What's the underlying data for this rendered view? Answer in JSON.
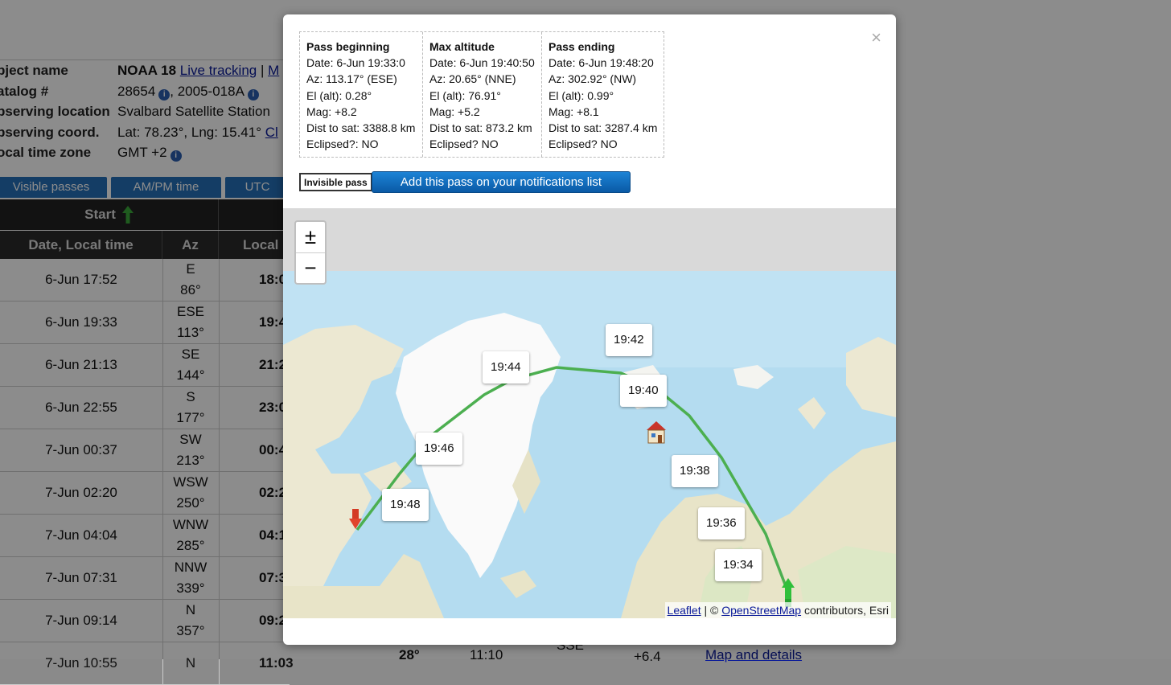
{
  "background": {
    "info": {
      "object_name_label": "bject name",
      "object_name": "NOAA 18",
      "live_tracking": "Live tracking",
      "sep": " | ",
      "more": "M",
      "catalog_label": "atalog #",
      "catalog": "28654",
      "intl": ", 2005-018A",
      "location_label": "bserving location",
      "location": "Svalbard Satellite Station",
      "coord_label": "bserving coord.",
      "coord": "Lat: 78.23°, Lng: 15.41°",
      "coord_link": "Cl",
      "tz_label": "ocal time zone",
      "tz": "GMT +2"
    },
    "tabs": [
      "Visible passes",
      "AM/PM time",
      "UTC"
    ],
    "table_head": {
      "start": "Start",
      "date_col": "Date, Local time",
      "az_col": "Az",
      "local_col": "Local"
    },
    "rows": [
      {
        "date": "6-Jun 17:52",
        "dir": "E",
        "deg": "86°",
        "t": "18:0"
      },
      {
        "date": "6-Jun 19:33",
        "dir": "ESE",
        "deg": "113°",
        "t": "19:4"
      },
      {
        "date": "6-Jun 21:13",
        "dir": "SE",
        "deg": "144°",
        "t": "21:2"
      },
      {
        "date": "6-Jun 22:55",
        "dir": "S",
        "deg": "177°",
        "t": "23:0"
      },
      {
        "date": "7-Jun 00:37",
        "dir": "SW",
        "deg": "213°",
        "t": "00:4"
      },
      {
        "date": "7-Jun 02:20",
        "dir": "WSW",
        "deg": "250°",
        "t": "02:2"
      },
      {
        "date": "7-Jun 04:04",
        "dir": "WNW",
        "deg": "285°",
        "t": "04:1"
      },
      {
        "date": "7-Jun 07:31",
        "dir": "NNW",
        "deg": "339°",
        "t": "07:3"
      },
      {
        "date": "7-Jun 09:14",
        "dir": "N",
        "deg": "357°",
        "t": "09:2"
      },
      {
        "date": "7-Jun 10:55",
        "dir": "N",
        "deg": "",
        "t": "11:03"
      }
    ],
    "last_row_extra": {
      "e": "E",
      "alt": "28°",
      "time": "11:10",
      "dir": "SSE",
      "mag": "+6.4",
      "link": "Map and details"
    }
  },
  "modal": {
    "close": "×",
    "beginning": {
      "title": "Pass beginning",
      "date": "Date: 6-Jun 19:33:0",
      "az": "Az: 113.17° (ESE)",
      "el": "El (alt): 0.28°",
      "mag": "Mag: +8.2",
      "dist": "Dist to sat: 3388.8 km",
      "eclipsed": "Eclipsed?: NO"
    },
    "max": {
      "title": "Max altitude",
      "date": "Date: 6-Jun 19:40:50",
      "az": "Az: 20.65° (NNE)",
      "el": "El (alt): 76.91°",
      "mag": "Mag: +5.2",
      "dist": "Dist to sat: 873.2 km",
      "eclipsed": "Eclipsed? NO"
    },
    "ending": {
      "title": "Pass ending",
      "date": "Date: 6-Jun 19:48:20",
      "az": "Az: 302.92° (NW)",
      "el": "El (alt): 0.99°",
      "mag": "Mag: +8.1",
      "dist": "Dist to sat: 3287.4 km",
      "eclipsed": "Eclipsed? NO"
    },
    "invisible_label": "Invisible pass",
    "notify_label": "Add this pass on your notifications list",
    "map": {
      "zoom_in": "±",
      "zoom_out": "−",
      "time_labels": [
        "19:42",
        "19:44",
        "19:40",
        "19:46",
        "19:38",
        "19:48",
        "19:36",
        "19:34"
      ],
      "attribution": {
        "leaflet": "Leaflet",
        "sep": " | © ",
        "osm": "OpenStreetMap",
        "rest": " contributors, Esri"
      },
      "colors": {
        "track": "#4caf50",
        "sea": "#b4dcf0",
        "land": "#ece8d2",
        "ice": "#fafafa"
      }
    }
  }
}
